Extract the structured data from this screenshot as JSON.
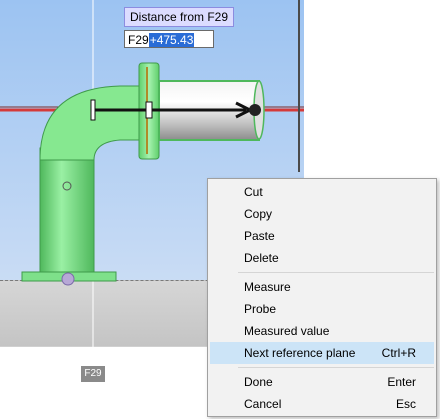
{
  "dimension": {
    "title": "Distance from F29",
    "input_prefix": "F29",
    "input_selected": "+475.43"
  },
  "reference_plane_tag": "F29",
  "context_menu": {
    "groups": [
      [
        {
          "label": "Cut",
          "shortcut": ""
        },
        {
          "label": "Copy",
          "shortcut": ""
        },
        {
          "label": "Paste",
          "shortcut": ""
        },
        {
          "label": "Delete",
          "shortcut": ""
        }
      ],
      [
        {
          "label": "Measure",
          "shortcut": ""
        },
        {
          "label": "Probe",
          "shortcut": ""
        },
        {
          "label": "Measured value",
          "shortcut": ""
        },
        {
          "label": "Next reference plane",
          "shortcut": "Ctrl+R",
          "highlighted": true
        }
      ],
      [
        {
          "label": "Done",
          "shortcut": "Enter"
        },
        {
          "label": "Cancel",
          "shortcut": "Esc"
        }
      ]
    ]
  },
  "colors": {
    "pipe_green": "#7ee08a",
    "selection_blue": "#2a6cd6",
    "menu_highlight": "#cce4f7",
    "axis_red": "#d43a3a"
  }
}
